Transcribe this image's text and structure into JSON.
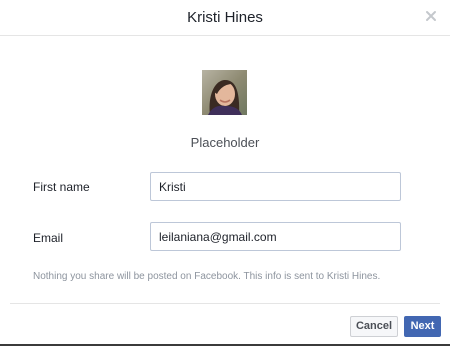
{
  "dialog": {
    "title": "Kristi Hines"
  },
  "profile": {
    "avatar_description": "avatar",
    "placeholder_label": "Placeholder"
  },
  "form": {
    "first_name_label": "First name",
    "first_name_value": "Kristi",
    "email_label": "Email",
    "email_value": "leilaniana@gmail.com"
  },
  "notice": "Nothing you share will be posted on Facebook. This info is sent to Kristi Hines.",
  "footer": {
    "cancel_label": "Cancel",
    "next_label": "Next"
  },
  "colors": {
    "primary": "#4267b2",
    "muted_text": "#8d949e"
  },
  "icons": {
    "close": "close-icon"
  }
}
